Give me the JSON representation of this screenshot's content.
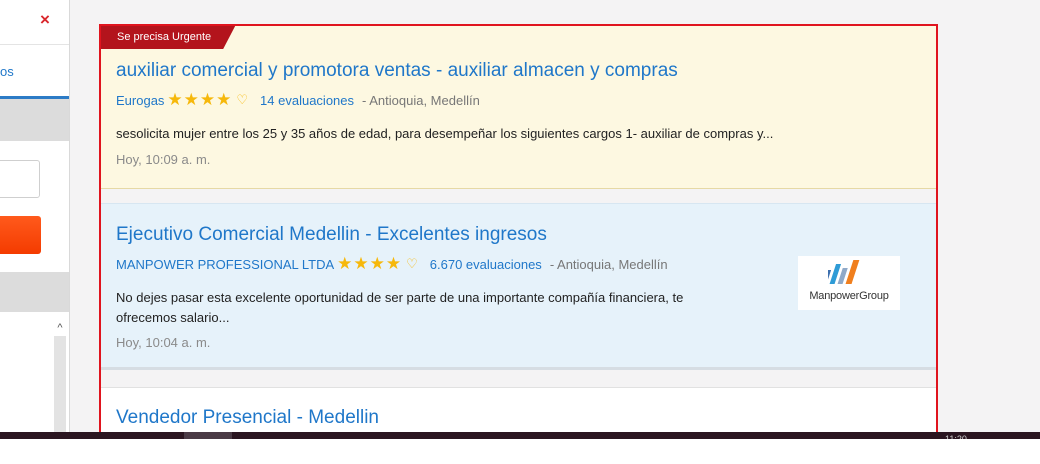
{
  "left_panel": {
    "close_icon": "×",
    "link_partial": "os",
    "scroll_up_icon": "^"
  },
  "results": [
    {
      "badge": "Se precisa Urgente",
      "title": "auxiliar comercial y promotora ventas - auxiliar almacen y compras",
      "company": "Eurogas",
      "stars": "★★★★",
      "fav_icon": "♡",
      "reviews": "14 evaluaciones",
      "location": "- Antioquia, Medellín",
      "description": "sesolicita mujer entre los 25 y 35 años de edad, para desempeñar los siguientes cargos 1- auxiliar de compras y...",
      "time": "Hoy, 10:09 a. m."
    },
    {
      "title": "Ejecutivo Comercial Medellin - Excelentes ingresos",
      "company": "MANPOWER PROFESSIONAL LTDA",
      "stars": "★★★★",
      "fav_icon": "♡",
      "reviews": "6.670 evaluaciones",
      "location": "- Antioquia, Medellín",
      "description_line1": "No dejes pasar esta excelente oportunidad de ser parte de una importante compañía financiera, te",
      "description_line2": "ofrecemos salario...",
      "time": "Hoy, 10:04 a. m.",
      "logo_text": "ManpowerGroup",
      "logo_colors": [
        "#3d6fae",
        "#2e9bd6",
        "#8fa9c8",
        "#f07f1e"
      ]
    },
    {
      "title": "Vendedor Presencial - Medellin"
    }
  ],
  "taskbar": {
    "clock_partial": "11:20"
  },
  "colors": {
    "accent_blue": "#1f77c9",
    "urgent_red": "#b3141c",
    "highlight_border": "#e0141e",
    "star_yellow": "#f6b80b"
  }
}
